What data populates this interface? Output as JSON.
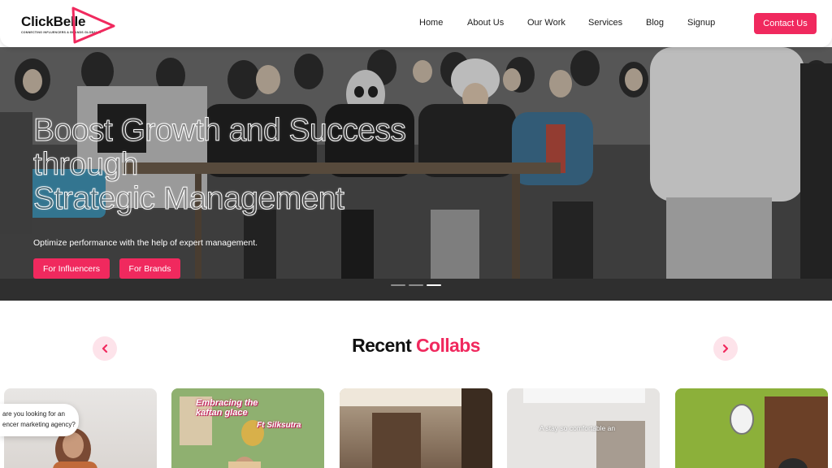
{
  "brand": {
    "name": "ClickBelle",
    "tagline": "CONNECTING INFLUENCERS & BRANDS GLOBALLY",
    "accent_color": "#f0295e",
    "logo_icon": "play-triangle-icon"
  },
  "nav": {
    "items": [
      "Home",
      "About Us",
      "Our Work",
      "Services",
      "Blog",
      "Signup"
    ],
    "cta": "Contact Us"
  },
  "hero": {
    "title_lines": [
      "Boost Growth and Success",
      "through",
      "Strategic Management"
    ],
    "subtitle": "Optimize performance with the help of expert management.",
    "buttons": [
      "For Influencers",
      "For Brands"
    ],
    "slide_count": 3,
    "active_slide": 2
  },
  "collabs": {
    "title_main": "Recent",
    "title_accent": "Collabs",
    "prev_icon": "chevron-left-icon",
    "next_icon": "chevron-right-icon",
    "cards": [
      {
        "caption": ""
      },
      {
        "caption_line1": "Embracing the",
        "caption_line2": "kaftan glace",
        "caption_line3": "Ft Silksutra"
      },
      {
        "caption": ""
      },
      {
        "caption": "A stay so comfortable an"
      },
      {
        "caption": ""
      }
    ]
  },
  "chat_widget": {
    "line1": "are you looking for an",
    "line2": "encer marketing agency?"
  }
}
